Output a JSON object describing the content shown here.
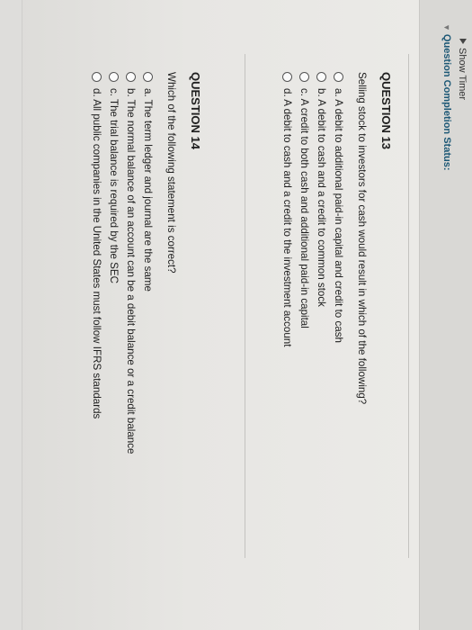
{
  "header": {
    "timer_label": "Show Timer",
    "status_label": "Question Completion Status:"
  },
  "questions": [
    {
      "title": "QUESTION 13",
      "prompt": "Selling stock to investors for cash would result in which of the following?",
      "choices": [
        "a. A debit to additional paid-in capital and credit to cash",
        "b. A debit to cash and a credit to common stock",
        "c. A credit to both cash and additional paid-in capital",
        "d. A debit to cash and a credit to the investment account"
      ]
    },
    {
      "title": "QUESTION 14",
      "prompt": "Which of the following statement is correct?",
      "choices": [
        "a. The term ledger and journal are the same",
        "b. The normal balance of an account can be a debit balance or a credit balance",
        "c. The trial balance is required by the SEC",
        "d. All public companies in the United States must follow IFRS standards"
      ]
    }
  ],
  "colors": {
    "status_text": "#1d5876",
    "background": "#e7e6e3"
  }
}
